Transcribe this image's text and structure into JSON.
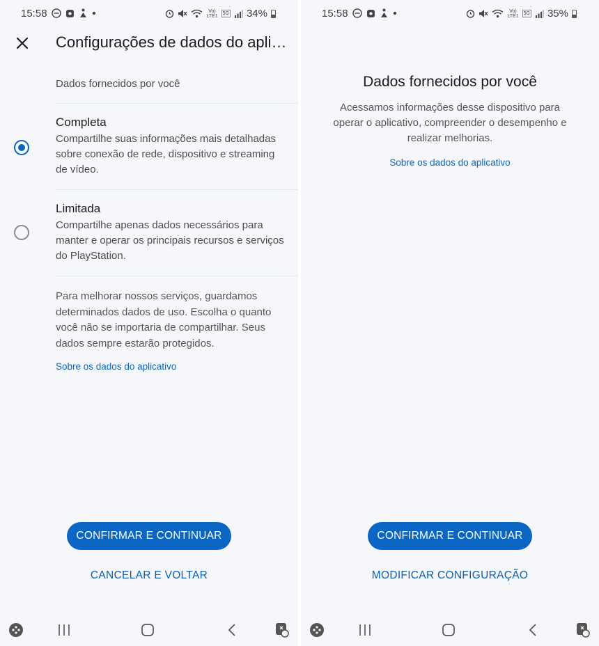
{
  "left": {
    "status": {
      "time": "15:58",
      "battery": "34%",
      "volte": "Vo)",
      "lte": "LTE1",
      "net": "5G"
    },
    "header": {
      "title": "Configurações de dados do aplicativo"
    },
    "section_label": "Dados fornecidos por você",
    "options": [
      {
        "title": "Completa",
        "description": "Compartilhe suas informações mais detalhadas sobre conexão de rede, dispositivo e streaming de vídeo.",
        "selected": true
      },
      {
        "title": "Limitada",
        "description": "Compartilhe apenas dados necessários para manter e operar os principais recursos e serviços do PlayStation.",
        "selected": false
      }
    ],
    "paragraph": "Para melhorar nossos serviços, guardamos determinados dados de uso. Escolha o quanto você não se importaria de compartilhar. Seus dados sempre estarão protegidos.",
    "link": "Sobre os dados do aplicativo",
    "primary_button": "CONFIRMAR E CONTINUAR",
    "secondary_button": "CANCELAR E VOLTAR"
  },
  "right": {
    "status": {
      "time": "15:58",
      "battery": "35%",
      "volte": "Vo)",
      "lte": "LTE1",
      "net": "5G"
    },
    "title": "Dados fornecidos por você",
    "description": "Acessamos informações desse dispositivo para operar o aplicativo, compreender o desempenho e realizar melhorias.",
    "link": "Sobre os dados do aplicativo",
    "primary_button": "CONFIRMAR E CONTINUAR",
    "secondary_button": "MODIFICAR CONFIGURAÇÃO"
  },
  "colors": {
    "accent": "#0a66c2",
    "background": "#f5f7fb"
  },
  "icons": [
    "close-icon",
    "radio-selected-icon",
    "radio-unselected-icon",
    "game-launcher-icon",
    "recent-apps-icon",
    "home-icon",
    "back-icon",
    "screenshot-assist-icon"
  ]
}
